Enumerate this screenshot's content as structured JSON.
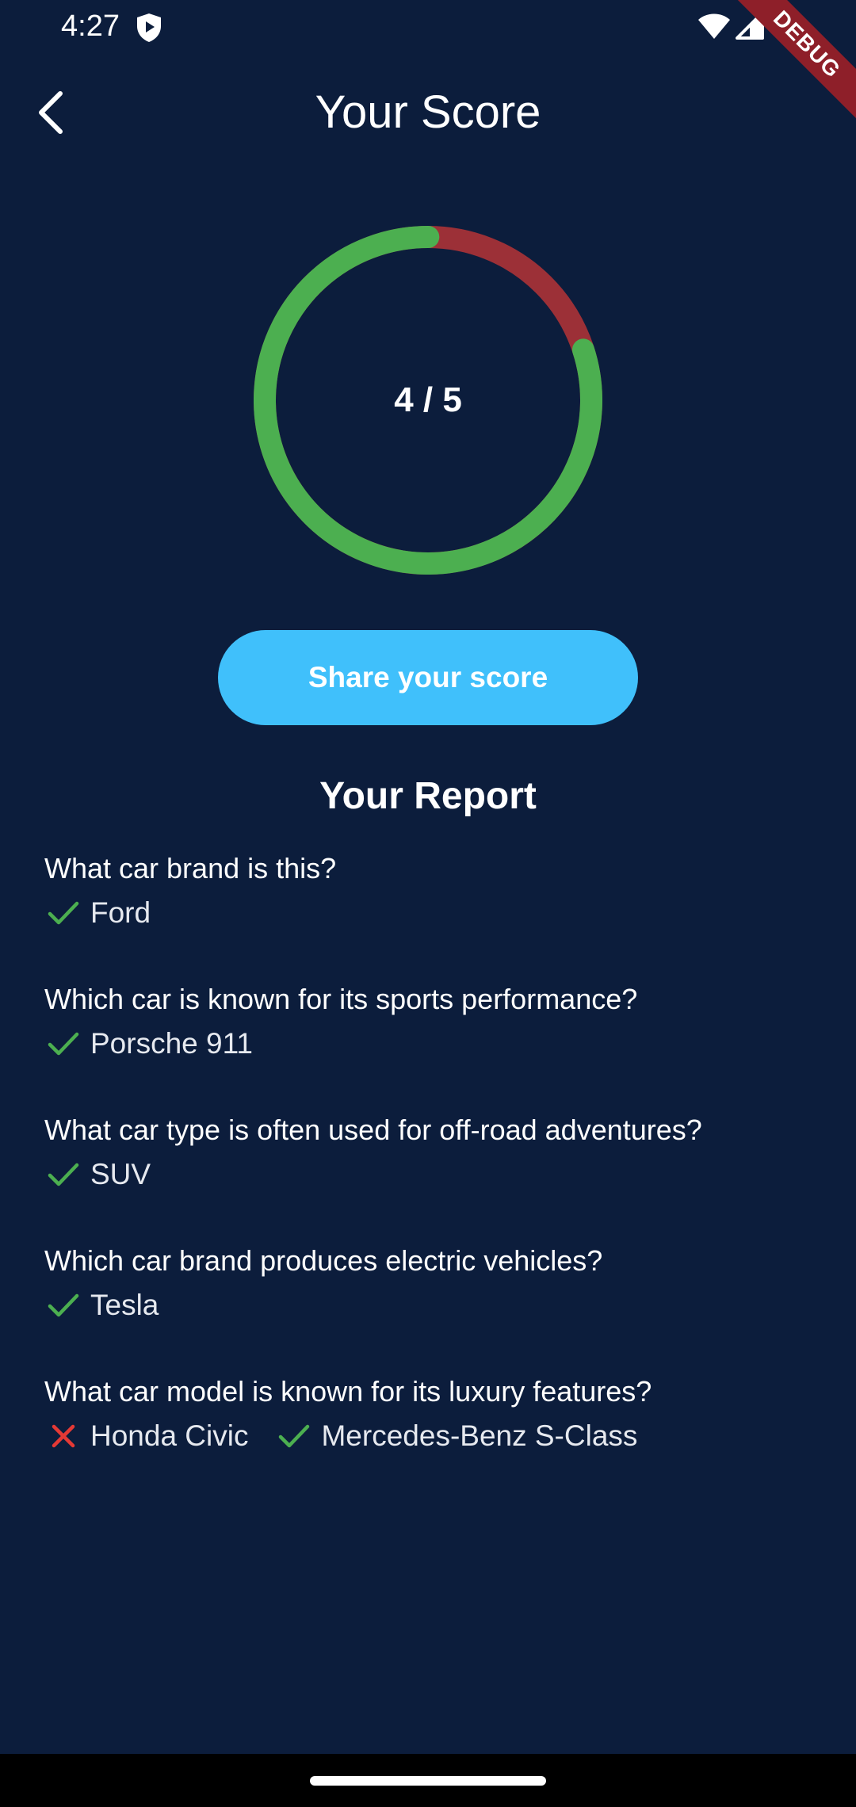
{
  "status_bar": {
    "time": "4:27",
    "icons": [
      "shield-play-icon",
      "wifi-icon",
      "cellular-signal-icon"
    ]
  },
  "debug_banner": {
    "label": "DEBUG",
    "color": "#8e1f29"
  },
  "app_bar": {
    "title": "Your Score",
    "back_icon": "chevron-left-icon"
  },
  "score": {
    "label": "4 / 5",
    "correct": 4,
    "total": 5,
    "correct_color": "#4caf50",
    "incorrect_color": "#9c3037"
  },
  "share": {
    "label": "Share your score",
    "color": "#40c0fb"
  },
  "report": {
    "title": "Your Report",
    "items": [
      {
        "question": "What car brand is this?",
        "answers": [
          {
            "status": "correct",
            "text": "Ford"
          }
        ]
      },
      {
        "question": "Which car is known for its sports performance?",
        "answers": [
          {
            "status": "correct",
            "text": "Porsche 911"
          }
        ]
      },
      {
        "question": "What car type is often used for off-road adventures?",
        "answers": [
          {
            "status": "correct",
            "text": "SUV"
          }
        ]
      },
      {
        "question": "Which car brand produces electric vehicles?",
        "answers": [
          {
            "status": "correct",
            "text": "Tesla"
          }
        ]
      },
      {
        "question": "What car model is known for its luxury features?",
        "answers": [
          {
            "status": "incorrect",
            "text": "Honda Civic"
          },
          {
            "status": "correct",
            "text": "Mercedes-Benz S-Class"
          }
        ]
      }
    ]
  },
  "colors": {
    "background": "#0c1d3c",
    "check": "#4caf50",
    "cross": "#e53935"
  }
}
